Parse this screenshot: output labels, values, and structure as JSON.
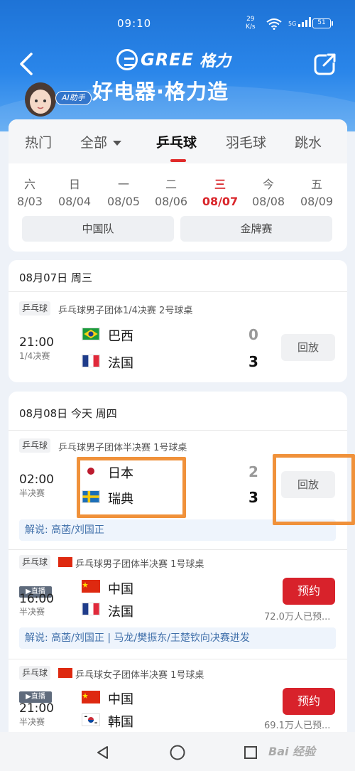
{
  "status_bar": {
    "time": "09:10",
    "speed": "29",
    "speed_unit": "K/s",
    "signal": "5G",
    "battery": "51"
  },
  "header": {
    "brand_name": "GREE",
    "brand_cn": "格力",
    "slogan": "好电器·格力造",
    "ai_badge": "AI助手"
  },
  "tabs": [
    {
      "label": "热门"
    },
    {
      "label": "全部"
    },
    {
      "label": "乒乓球",
      "active": true
    },
    {
      "label": "羽毛球"
    },
    {
      "label": "跳水"
    }
  ],
  "dates": [
    {
      "weekday": "六",
      "date": "8/03"
    },
    {
      "weekday": "日",
      "date": "08/04"
    },
    {
      "weekday": "一",
      "date": "08/05"
    },
    {
      "weekday": "二",
      "date": "08/06"
    },
    {
      "weekday": "三",
      "date": "08/07",
      "active": true
    },
    {
      "weekday": "今",
      "date": "08/08"
    },
    {
      "weekday": "五",
      "date": "08/09"
    }
  ],
  "filters": [
    "中国队",
    "金牌赛"
  ],
  "day1": {
    "heading": "08月07日 周三",
    "match": {
      "sport_tag": "乒乓球",
      "event": "乒乓球男子团体1/4决赛 2号球桌",
      "time": "21:00",
      "stage": "1/4决赛",
      "team1": "巴西",
      "score1": "0",
      "team2": "法国",
      "score2": "3",
      "action": "回放"
    }
  },
  "day2": {
    "heading": "08月08日 今天 周四",
    "match1": {
      "sport_tag": "乒乓球",
      "event": "乒乓球男子团体半决赛 1号球桌",
      "time": "02:00",
      "stage": "半决赛",
      "team1": "日本",
      "score1": "2",
      "team2": "瑞典",
      "score2": "3",
      "action": "回放",
      "commentary": "解说: 高菡/刘国正"
    },
    "match2": {
      "sport_tag": "乒乓球",
      "event": "乒乓球男子团体半决赛 1号球桌",
      "live_tag": "▶直播",
      "time": "16:00",
      "stage": "半决赛",
      "team1": "中国",
      "team2": "法国",
      "action": "预约",
      "booked": "72.0万人已预...",
      "commentary": "解说: 高菡/刘国正 | 马龙/樊振东/王楚钦向决赛进发"
    },
    "match3": {
      "sport_tag": "乒乓球",
      "event": "乒乓球女子团体半决赛 1号球桌",
      "live_tag": "▶直播",
      "time": "21:00",
      "stage": "半决赛",
      "team1": "中国",
      "team2": "韩国",
      "action": "预约",
      "booked": "69.1万人已预..."
    }
  },
  "watermark": "Bai 经验",
  "colors": {
    "header_blue": "#2a86ea",
    "accent_red": "#d8222b",
    "highlight_orange": "#f0913a",
    "commentary_blue": "#3e6ea9"
  }
}
